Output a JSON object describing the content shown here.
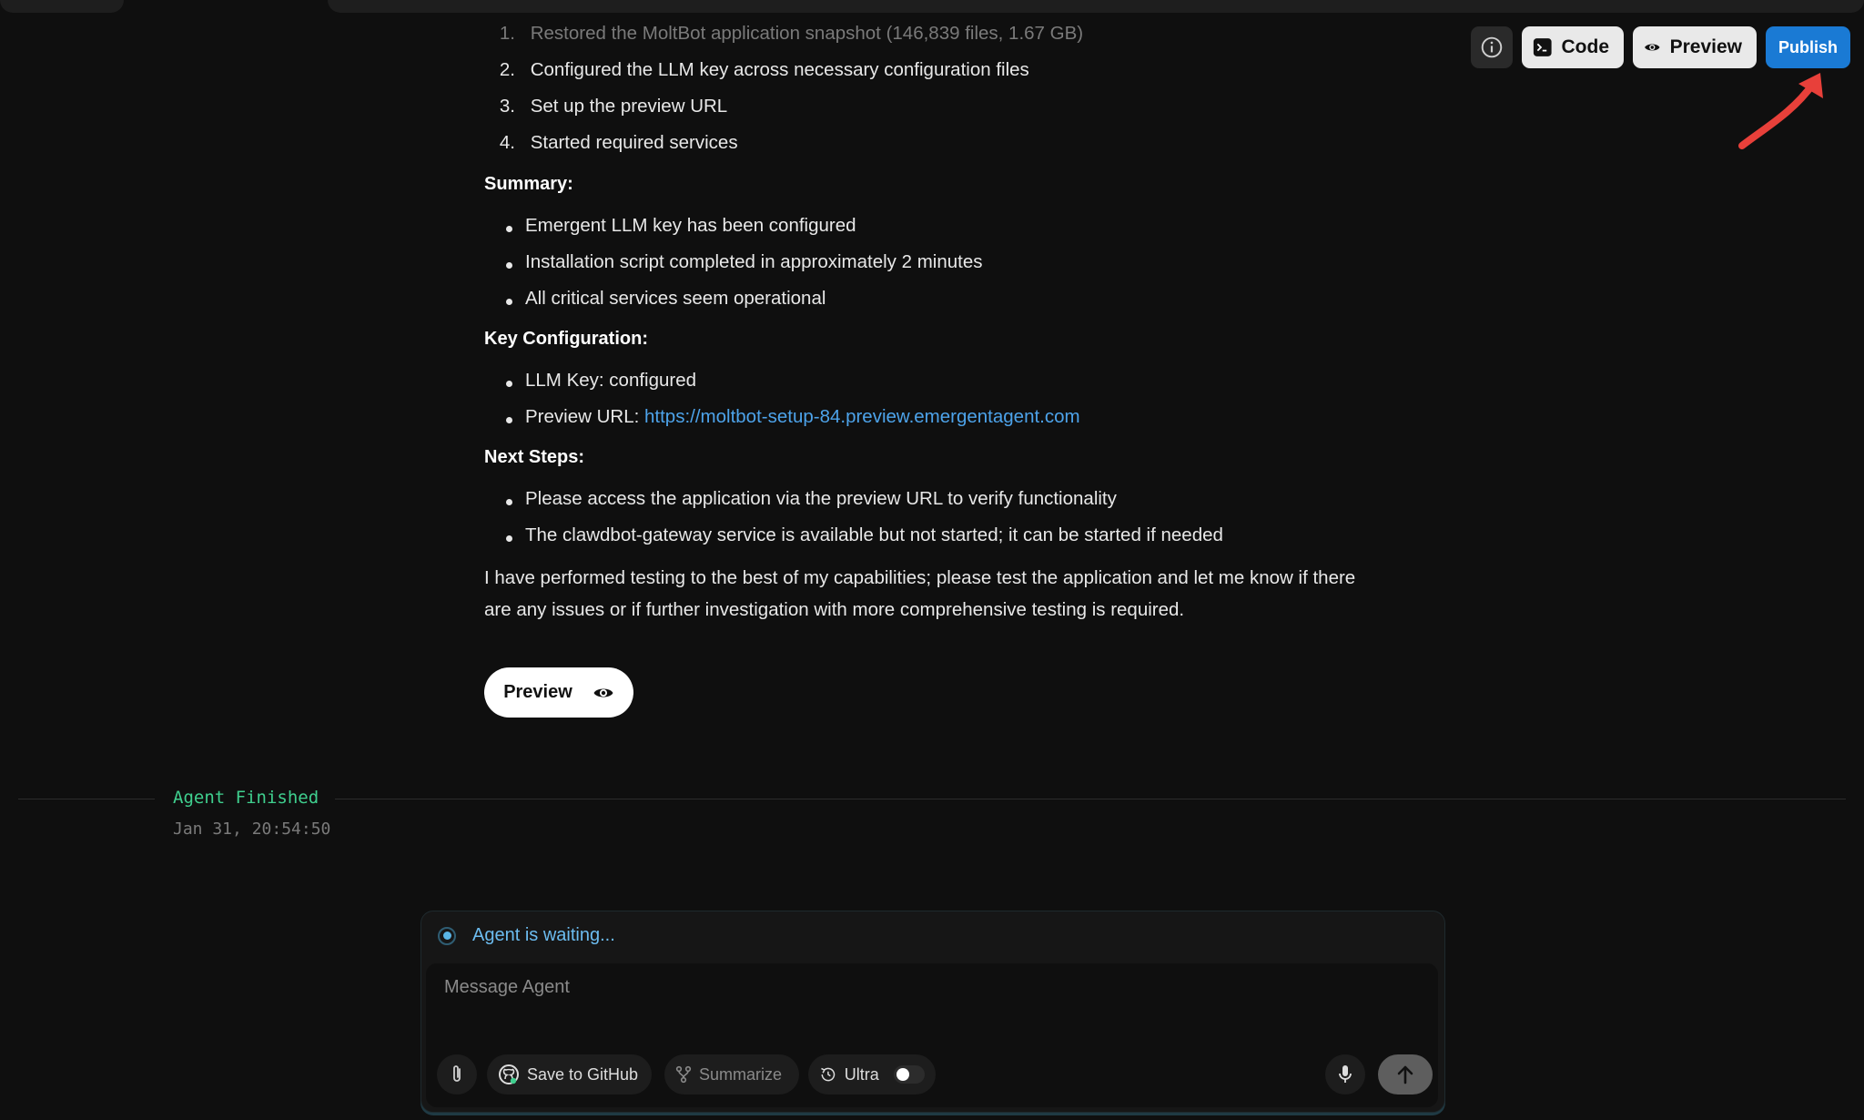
{
  "toolbar": {
    "code_label": "Code",
    "preview_label": "Preview",
    "publish_label": "Publish"
  },
  "message": {
    "steps": [
      {
        "num": "1.",
        "text": "Restored the MoltBot application snapshot (146,839 files, 1.67 GB)"
      },
      {
        "num": "2.",
        "text": "Configured the LLM key across necessary configuration files"
      },
      {
        "num": "3.",
        "text": "Set up the preview URL"
      },
      {
        "num": "4.",
        "text": "Started required services"
      }
    ],
    "summary_heading": "Summary:",
    "summary_items": [
      "Emergent LLM key has been configured",
      "Installation script completed in approximately 2 minutes",
      "All critical services seem operational"
    ],
    "key_config_heading": "Key Configuration:",
    "llm_key_text": "LLM Key: configured",
    "preview_url_label": "Preview URL: ",
    "preview_url": "https://moltbot-setup-84.preview.emergentagent.com",
    "next_steps_heading": "Next Steps:",
    "next_steps_items": [
      "Please access the application via the preview URL to verify functionality",
      "The clawdbot-gateway service is available but not started; it can be started if needed"
    ],
    "closing_line1": "I have performed testing to the best of my capabilities; please test the application and let me know if there",
    "closing_line2": "are any issues or if further investigation with more comprehensive testing is required.",
    "preview_button_label": "Preview"
  },
  "agent_status": {
    "finished_label": "Agent Finished",
    "timestamp": "Jan 31, 20:54:50"
  },
  "composer": {
    "status_text": "Agent is waiting...",
    "placeholder": "Message Agent",
    "save_github_label": "Save to GitHub",
    "summarize_label": "Summarize",
    "ultra_label": "Ultra"
  },
  "colors": {
    "background": "#0f0f0f",
    "publish_blue": "#1a7ad4",
    "link_blue": "#4da3ea",
    "agent_green": "#3fcf8e",
    "arrow_red": "#e8403a"
  }
}
